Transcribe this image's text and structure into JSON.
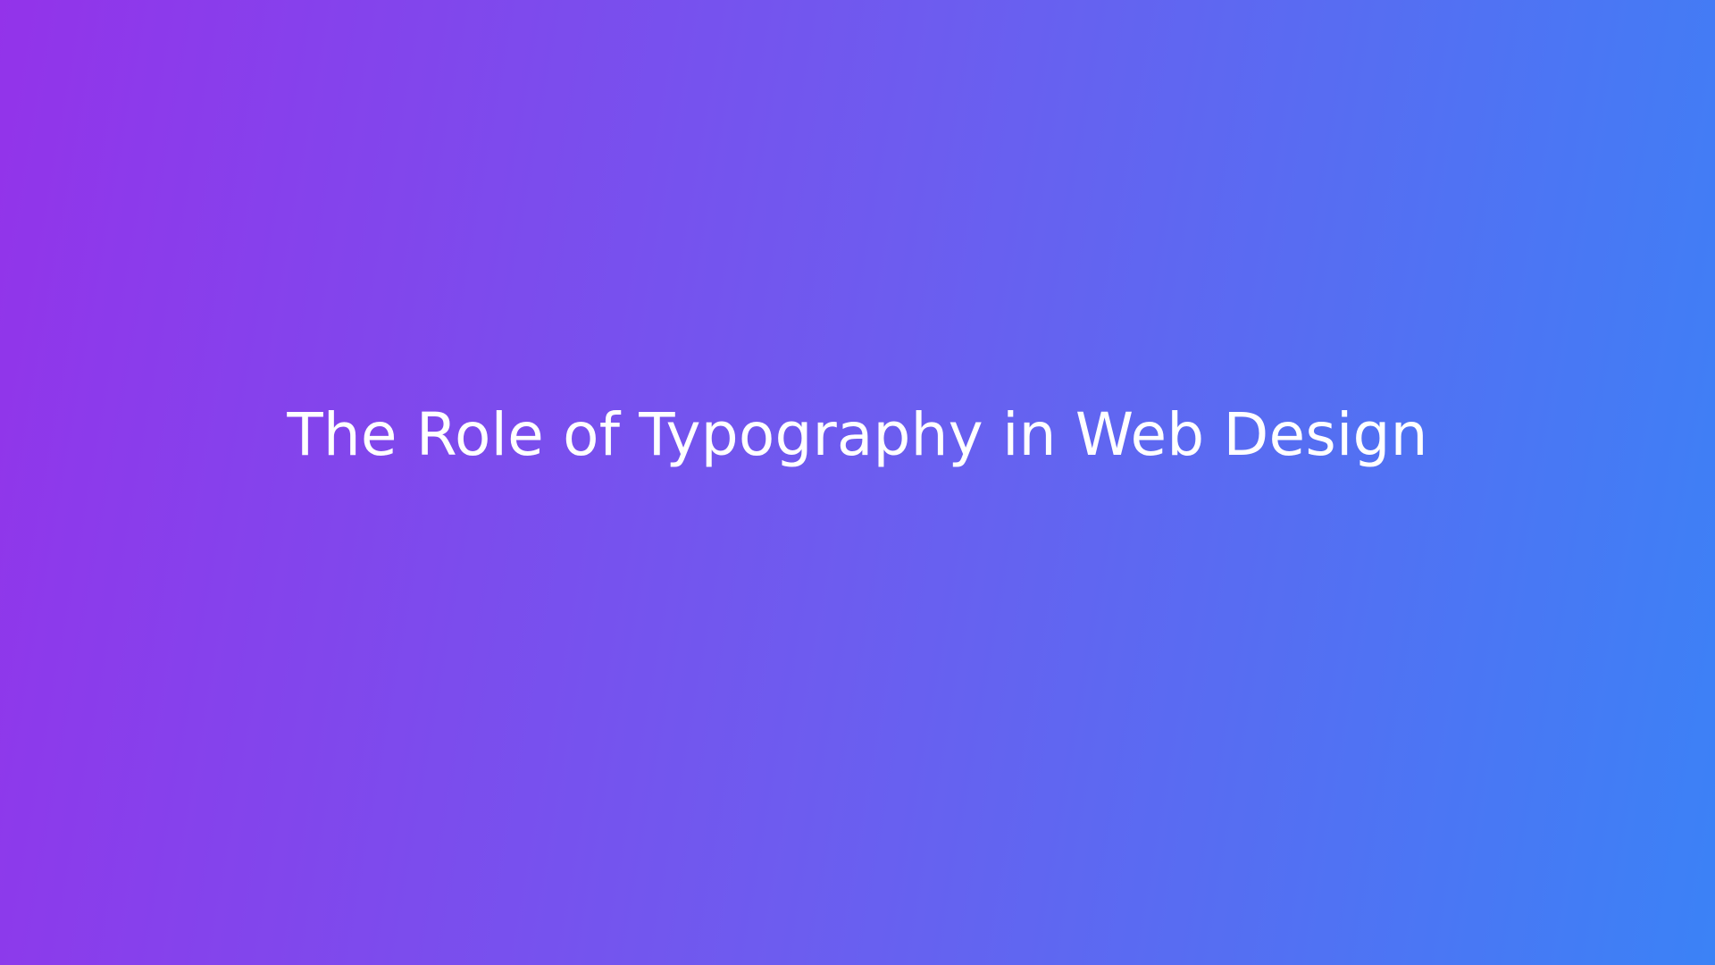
{
  "hero": {
    "title": "The Role of Typography in Web Design",
    "gradient_start": "#9333ea",
    "gradient_end": "#3b82f6",
    "text_color": "#ffffff"
  }
}
